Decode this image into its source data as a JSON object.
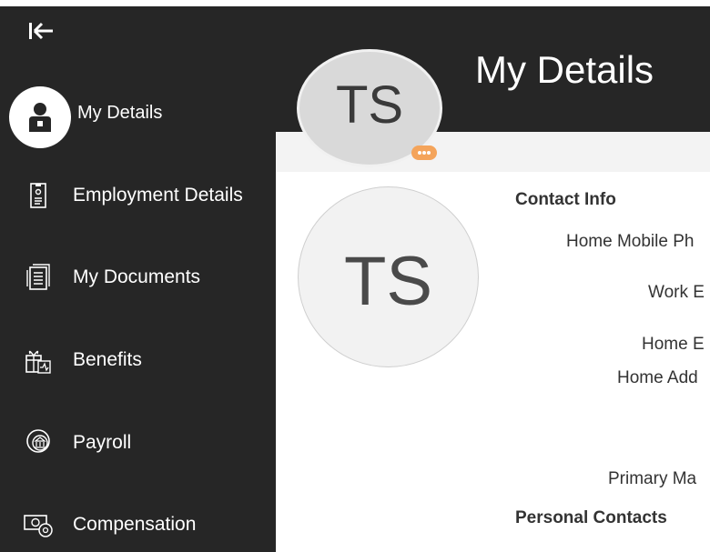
{
  "sidebar": {
    "collapse_icon": "collapse-left-icon",
    "items": [
      {
        "label": "My Details",
        "icon": "person-badge-icon",
        "active": true
      },
      {
        "label": "Employment Details",
        "icon": "id-card-icon",
        "active": false
      },
      {
        "label": "My Documents",
        "icon": "documents-icon",
        "active": false
      },
      {
        "label": "Benefits",
        "icon": "gift-health-icon",
        "active": false
      },
      {
        "label": "Payroll",
        "icon": "bank-coin-icon",
        "active": false
      },
      {
        "label": "Compensation",
        "icon": "money-gear-icon",
        "active": false
      }
    ]
  },
  "header": {
    "title": "My Details",
    "avatar_initials": "TS"
  },
  "profile": {
    "avatar_initials": "TS"
  },
  "content": {
    "contact_info_title": "Contact Info",
    "fields": [
      "Home Mobile Ph",
      "Work E",
      "Home E",
      "Home Add",
      "Primary Ma"
    ],
    "personal_contacts_title": "Personal Contacts"
  },
  "colors": {
    "sidebar_bg": "#262626",
    "accent": "#f4a45b"
  }
}
